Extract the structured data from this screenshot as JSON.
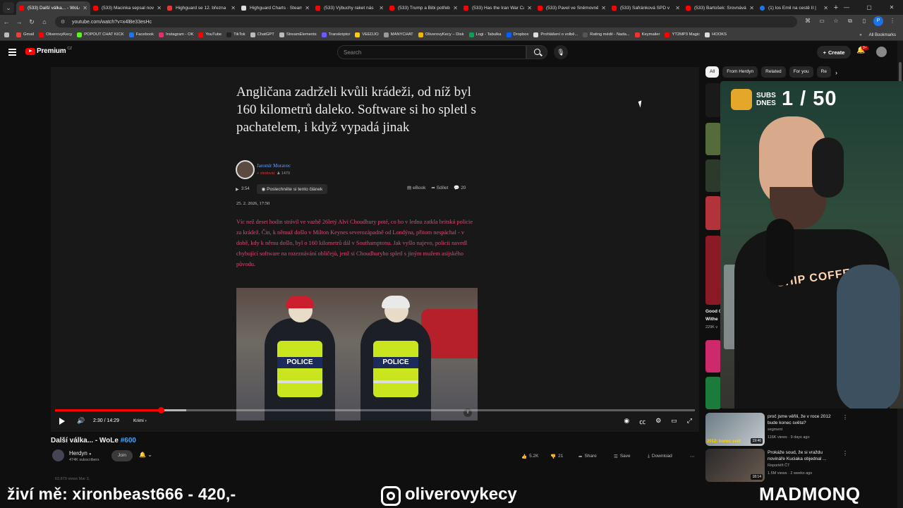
{
  "browser": {
    "tabs": [
      {
        "title": "(533) Další válka... - WoLe",
        "active": true,
        "icon": "youtube"
      },
      {
        "title": "(533) Macinka sepsal nov",
        "icon": "youtube"
      },
      {
        "title": "Highguard se 12. března",
        "icon": "red"
      },
      {
        "title": "Highguard Charts · Steam",
        "icon": "steam"
      },
      {
        "title": "(533) Výbuchy raket nás",
        "icon": "youtube"
      },
      {
        "title": "(533) Trump a Bibi potřeb",
        "icon": "youtube"
      },
      {
        "title": "(533) Has the Iran War Ca",
        "icon": "youtube"
      },
      {
        "title": "(533) Pavel ve Sněmovně",
        "icon": "youtube"
      },
      {
        "title": "(533) Šafránková SPD v",
        "icon": "youtube"
      },
      {
        "title": "(533) Bartošek: Srovnává",
        "icon": "youtube"
      },
      {
        "title": "(1) los Emil na cestě II |",
        "icon": "facebook"
      }
    ],
    "url": "youtube.com/watch?v=x4lBe33esHc",
    "bookmarks": [
      {
        "label": "Gmail",
        "color": "#ea4335"
      },
      {
        "label": "OliverovyKecy",
        "color": "#ff0000"
      },
      {
        "label": "POPOUT CHAT KICK",
        "color": "#53fc18"
      },
      {
        "label": "Facebook",
        "color": "#1877f2"
      },
      {
        "label": "Instagram - OK",
        "color": "#e1306c"
      },
      {
        "label": "YouTube",
        "color": "#ff0000"
      },
      {
        "label": "TikTok",
        "color": "#222"
      },
      {
        "label": "ChatGPT",
        "color": "#bbb"
      },
      {
        "label": "StreamElements",
        "color": "#bbb"
      },
      {
        "label": "Transkriptor",
        "color": "#6b5bff"
      },
      {
        "label": "VEEDJO",
        "color": "#ffcc00"
      },
      {
        "label": "MANYCHAT",
        "color": "#999"
      },
      {
        "label": "OliverovyKecy – Disk",
        "color": "#f4b400"
      },
      {
        "label": "Logi - Tabulka",
        "color": "#0f9d58"
      },
      {
        "label": "Dropbox",
        "color": "#0061ff"
      },
      {
        "label": "Prohlášení o volbě...",
        "color": "#ddd"
      },
      {
        "label": "Rating médií - Nada...",
        "color": "#555"
      },
      {
        "label": "Keymailer",
        "color": "#e33"
      },
      {
        "label": "YT2MP3 Magic",
        "color": "#ff0000"
      },
      {
        "label": "HOOKS",
        "color": "#ddd"
      }
    ],
    "all_bookmarks": "All Bookmarks"
  },
  "youtube": {
    "brand": "Premium",
    "country": "CZ",
    "search_placeholder": "Search",
    "create_label": "Create",
    "notif_count": "9+",
    "chips": [
      "All",
      "From Herdyn",
      "Related",
      "For you",
      "Re"
    ]
  },
  "article": {
    "title": "Angličana zadrželi kvůli krádeži, od níž byl 160 kilometrů daleko. Software si ho spletl s pachatelem, i když vypadá jinak",
    "author": "Jaromír Moravec",
    "author_tag": "sledovat",
    "author_count": "1470",
    "duration": "3:54",
    "listen_label": "Poslechněte si tento článek",
    "ebook": "eBook",
    "share": "Sdílet",
    "comments": "20",
    "date": "25. 2. 2026, 17:50",
    "lead": "Víc než deset hodin strávil ve vazbě 26letý Alvi Choudhury poté, co ho v lednu zatkla britská policie za krádež. Čin, k němuž došlo v Milton Keynes severozápadně od Londýna, přitom nespáchal - v době, kdy k němu došlo, byl o 160 kilometrů dál v Southamptonu. Jak vyšlo najevo, policii navedl chybující software na rozeznávání obličejů, jenž si Choudhuryho spletl s jiným mužem asijského původu.",
    "photo_text": "POLICE"
  },
  "player": {
    "time": "2:30 / 14:29",
    "chapter": "Krimi",
    "played_fraction": 0.165,
    "buffer_fraction": 0.205,
    "info_icon": "i"
  },
  "video": {
    "title": "Další válka... - WoLe",
    "hashtag": "#600",
    "channel": "Herdyn",
    "subscribers": "474K subscribers",
    "join": "Join",
    "likes": "5.2K",
    "dislikes": "21",
    "share": "Share",
    "save": "Save",
    "download": "Download",
    "views": "63,879 views  Mar 3,"
  },
  "sidebar": {
    "fragment_title": "Good G",
    "fragment_title2": "Withe",
    "fragment_views": "229K v",
    "items": [
      {
        "title": "proč jsme věřili, že v roce 2012 bude konec světa?",
        "channel": "segment",
        "meta": "116K views · 9 days ago",
        "duration": "19:46",
        "thumb_text": "2012: konec svět"
      },
      {
        "title": "Prokáže soud, že si vraždu novináře Kuciaka objednal ...",
        "channel": "Reportéři ČT",
        "meta": "1.5M views · 2 weeks ago",
        "duration": "18:14"
      }
    ]
  },
  "overlay": {
    "subs_label": "SUBS DNES",
    "subs_count": "1 / 50",
    "shirt": "SHIP COFFEE",
    "left_text": "živí mě: xironbeast666 - 420,-",
    "instagram": "oliverovykecy",
    "right_text": "MADMONQ"
  },
  "colors": {
    "youtube_red": "#ff0000",
    "link_blue": "#3ea6ff",
    "article_lead": "#d94a72",
    "vest_yellow": "#c9e51e"
  }
}
